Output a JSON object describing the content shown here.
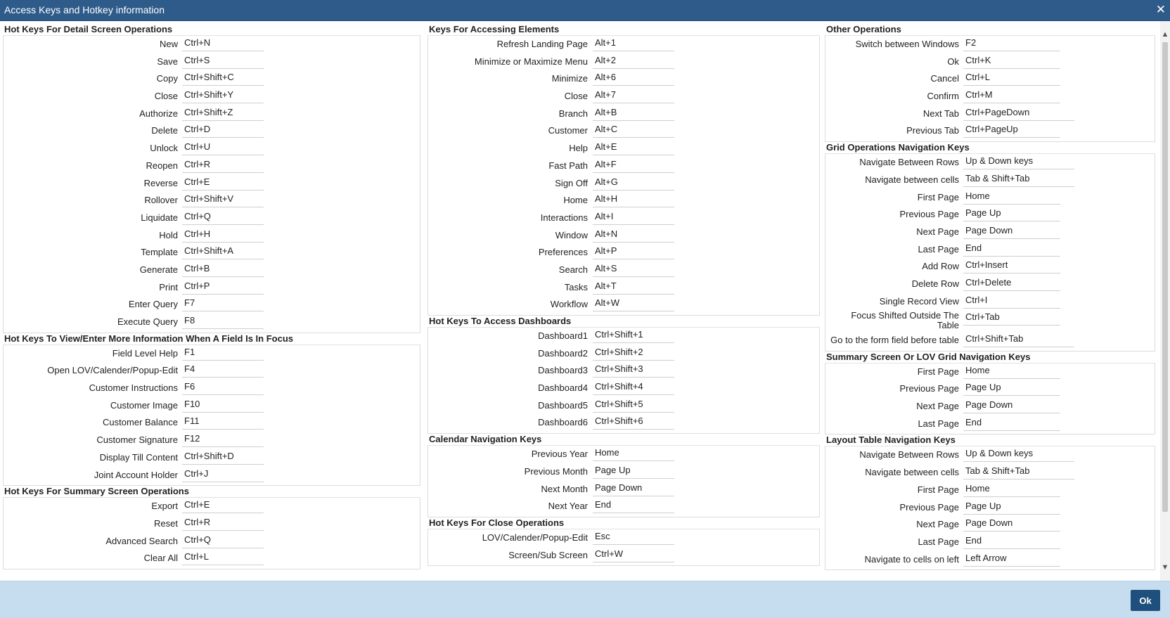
{
  "window": {
    "title": "Access Keys and Hotkey information",
    "close_glyph": "✕",
    "ok_label": "Ok"
  },
  "columns": [
    {
      "sections": [
        {
          "title": "Hot Keys For Detail Screen Operations",
          "items": [
            {
              "label": "New",
              "key": "Ctrl+N"
            },
            {
              "label": "Save",
              "key": "Ctrl+S"
            },
            {
              "label": "Copy",
              "key": "Ctrl+Shift+C"
            },
            {
              "label": "Close",
              "key": "Ctrl+Shift+Y"
            },
            {
              "label": "Authorize",
              "key": "Ctrl+Shift+Z"
            },
            {
              "label": "Delete",
              "key": "Ctrl+D"
            },
            {
              "label": "Unlock",
              "key": "Ctrl+U"
            },
            {
              "label": "Reopen",
              "key": "Ctrl+R"
            },
            {
              "label": "Reverse",
              "key": "Ctrl+E"
            },
            {
              "label": "Rollover",
              "key": "Ctrl+Shift+V"
            },
            {
              "label": "Liquidate",
              "key": "Ctrl+Q"
            },
            {
              "label": "Hold",
              "key": "Ctrl+H"
            },
            {
              "label": "Template",
              "key": "Ctrl+Shift+A"
            },
            {
              "label": "Generate",
              "key": "Ctrl+B"
            },
            {
              "label": "Print",
              "key": "Ctrl+P"
            },
            {
              "label": "Enter Query",
              "key": "F7"
            },
            {
              "label": "Execute Query",
              "key": "F8"
            }
          ]
        },
        {
          "title": "Hot Keys To View/Enter More Information When A Field Is In Focus",
          "items": [
            {
              "label": "Field Level Help",
              "key": "F1"
            },
            {
              "label": "Open LOV/Calender/Popup-Edit",
              "key": "F4"
            },
            {
              "label": "Customer Instructions",
              "key": "F6"
            },
            {
              "label": "Customer Image",
              "key": "F10"
            },
            {
              "label": "Customer Balance",
              "key": "F11"
            },
            {
              "label": "Customer Signature",
              "key": "F12"
            },
            {
              "label": "Display Till Content",
              "key": "Ctrl+Shift+D"
            },
            {
              "label": "Joint Account Holder",
              "key": "Ctrl+J"
            }
          ]
        },
        {
          "title": "Hot Keys For Summary Screen Operations",
          "items": [
            {
              "label": "Export",
              "key": "Ctrl+E"
            },
            {
              "label": "Reset",
              "key": "Ctrl+R"
            },
            {
              "label": "Advanced Search",
              "key": "Ctrl+Q"
            },
            {
              "label": "Clear All",
              "key": "Ctrl+L"
            }
          ]
        }
      ]
    },
    {
      "sections": [
        {
          "title": "Keys For Accessing Elements",
          "items": [
            {
              "label": "Refresh Landing Page",
              "key": "Alt+1"
            },
            {
              "label": "Minimize or Maximize Menu",
              "key": "Alt+2"
            },
            {
              "label": "Minimize",
              "key": "Alt+6"
            },
            {
              "label": "Close",
              "key": "Alt+7"
            },
            {
              "label": "Branch",
              "key": "Alt+B"
            },
            {
              "label": "Customer",
              "key": "Alt+C"
            },
            {
              "label": "Help",
              "key": "Alt+E"
            },
            {
              "label": "Fast Path",
              "key": "Alt+F"
            },
            {
              "label": "Sign Off",
              "key": "Alt+G"
            },
            {
              "label": "Home",
              "key": "Alt+H"
            },
            {
              "label": "Interactions",
              "key": "Alt+I"
            },
            {
              "label": "Window",
              "key": "Alt+N"
            },
            {
              "label": "Preferences",
              "key": "Alt+P"
            },
            {
              "label": "Search",
              "key": "Alt+S"
            },
            {
              "label": "Tasks",
              "key": "Alt+T"
            },
            {
              "label": "Workflow",
              "key": "Alt+W"
            }
          ]
        },
        {
          "title": "Hot Keys To Access Dashboards",
          "items": [
            {
              "label": "Dashboard1",
              "key": "Ctrl+Shift+1"
            },
            {
              "label": "Dashboard2",
              "key": "Ctrl+Shift+2"
            },
            {
              "label": "Dashboard3",
              "key": "Ctrl+Shift+3"
            },
            {
              "label": "Dashboard4",
              "key": "Ctrl+Shift+4"
            },
            {
              "label": "Dashboard5",
              "key": "Ctrl+Shift+5"
            },
            {
              "label": "Dashboard6",
              "key": "Ctrl+Shift+6"
            }
          ]
        },
        {
          "title": "Calendar Navigation Keys",
          "items": [
            {
              "label": "Previous Year",
              "key": "Home"
            },
            {
              "label": "Previous Month",
              "key": "Page Up"
            },
            {
              "label": "Next Month",
              "key": "Page Down"
            },
            {
              "label": "Next Year",
              "key": "End"
            }
          ]
        },
        {
          "title": "Hot Keys For Close Operations",
          "items": [
            {
              "label": "LOV/Calender/Popup-Edit",
              "key": "Esc"
            },
            {
              "label": "Screen/Sub Screen",
              "key": "Ctrl+W"
            }
          ]
        }
      ]
    },
    {
      "sections": [
        {
          "title": "Other Operations",
          "items": [
            {
              "label": "Switch between Windows",
              "key": "F2"
            },
            {
              "label": "Ok",
              "key": "Ctrl+K"
            },
            {
              "label": "Cancel",
              "key": "Ctrl+L"
            },
            {
              "label": "Confirm",
              "key": "Ctrl+M"
            },
            {
              "label": "Next Tab",
              "key": "Ctrl+PageDown"
            },
            {
              "label": "Previous Tab",
              "key": "Ctrl+PageUp"
            }
          ]
        },
        {
          "title": "Grid Operations Navigation Keys",
          "items": [
            {
              "label": "Navigate Between Rows",
              "key": "Up & Down keys"
            },
            {
              "label": "Navigate between cells",
              "key": "Tab & Shift+Tab"
            },
            {
              "label": "First Page",
              "key": "Home"
            },
            {
              "label": "Previous Page",
              "key": "Page Up"
            },
            {
              "label": "Next Page",
              "key": "Page Down"
            },
            {
              "label": "Last Page",
              "key": "End"
            },
            {
              "label": "Add Row",
              "key": "Ctrl+Insert"
            },
            {
              "label": "Delete Row",
              "key": "Ctrl+Delete"
            },
            {
              "label": "Single Record View",
              "key": "Ctrl+I"
            },
            {
              "label": "Focus Shifted Outside The Table",
              "key": "Ctrl+Tab",
              "wrap": true
            },
            {
              "label": "Go to the form field before table",
              "key": "Ctrl+Shift+Tab"
            }
          ]
        },
        {
          "title": "Summary Screen Or LOV Grid Navigation Keys",
          "items": [
            {
              "label": "First Page",
              "key": "Home"
            },
            {
              "label": "Previous Page",
              "key": "Page Up"
            },
            {
              "label": "Next Page",
              "key": "Page Down"
            },
            {
              "label": "Last Page",
              "key": "End"
            }
          ]
        },
        {
          "title": "Layout Table Navigation Keys",
          "items": [
            {
              "label": "Navigate Between Rows",
              "key": "Up & Down keys"
            },
            {
              "label": "Navigate between cells",
              "key": "Tab & Shift+Tab"
            },
            {
              "label": "First Page",
              "key": "Home"
            },
            {
              "label": "Previous Page",
              "key": "Page Up"
            },
            {
              "label": "Next Page",
              "key": "Page Down"
            },
            {
              "label": "Last Page",
              "key": "End"
            },
            {
              "label": "Navigate to cells on left",
              "key": "Left Arrow"
            }
          ]
        }
      ]
    }
  ],
  "scrollbar": {
    "up_glyph": "▲",
    "down_glyph": "▼"
  }
}
